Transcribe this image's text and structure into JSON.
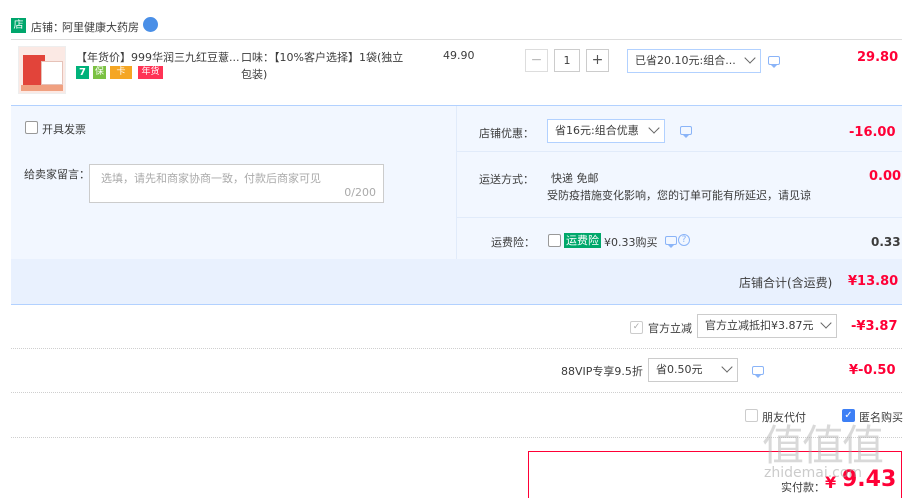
{
  "shop": {
    "badge": "店",
    "label": "店铺：",
    "name": "阿里健康大药房",
    "wangwang": "●"
  },
  "item": {
    "title": "【年货价】999华润三九红豆薏...",
    "tags": [
      "7",
      "保",
      "卡",
      "年货"
    ],
    "spec_label": "口味：【10%客户选择】1袋(独立包装)",
    "price": "49.90",
    "qty": "1",
    "minus": "−",
    "plus": "+",
    "discount_select": "已省20.10元:组合...",
    "subtotal": "29.80"
  },
  "invoice": {
    "label": "开具发票"
  },
  "message": {
    "label": "给卖家留言：",
    "placeholder": "选填，请先和商家协商一致，付款后商家可见",
    "counter": "0/200"
  },
  "shop_promo": {
    "label": "店铺优惠：",
    "select": "省16元:组合优惠",
    "amount": "-16.00"
  },
  "shipping": {
    "label": "运送方式：",
    "method": "快递 免邮",
    "note": "受防疫措施变化影响，您的订单可能有所延迟，请见谅",
    "amount": "0.00"
  },
  "insurance": {
    "label": "运费险：",
    "tag": "运费险",
    "text": "¥0.33购买",
    "amount": "0.33"
  },
  "shop_total": {
    "label": "店铺合计(含运费)",
    "amount": "¥13.80"
  },
  "official": {
    "label": "官方立减",
    "select": "官方立减抵扣¥3.87元",
    "amount": "-¥3.87"
  },
  "vip": {
    "label": "88VIP专享9.5折",
    "select": "省0.50元",
    "amount": "¥-0.50"
  },
  "options": {
    "friend_pay": "朋友代付",
    "anonymous": "匿名购买"
  },
  "pay": {
    "label": "实付款：",
    "currency": "¥",
    "amount": "9.43"
  },
  "watermark": {
    "big": "值值值",
    "small": "zhidemai.com"
  }
}
